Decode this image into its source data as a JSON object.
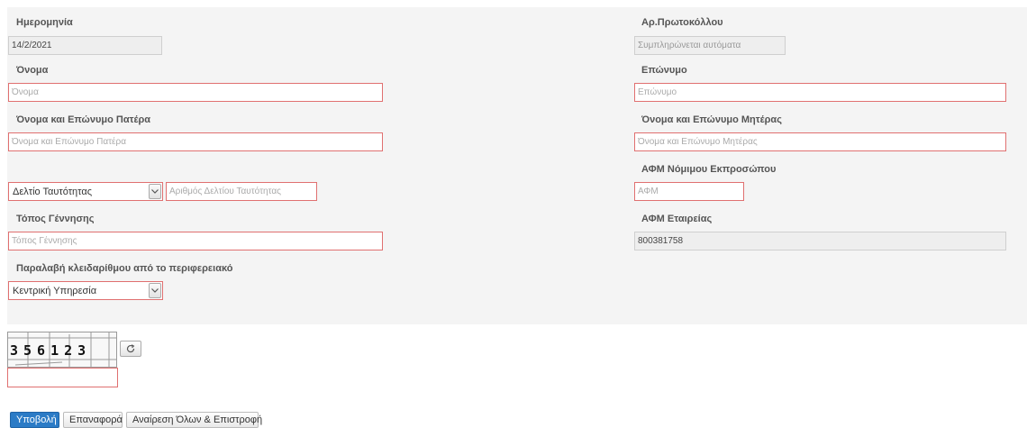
{
  "form": {
    "date": {
      "label": "Ημερομηνία",
      "value": "14/2/2021"
    },
    "protocol": {
      "label": "Αρ.Πρωτοκόλλου",
      "placeholder": "Συμπληρώνεται αυτόματα"
    },
    "first_name": {
      "label": "Όνομα",
      "placeholder": "Όνομα"
    },
    "last_name": {
      "label": "Επώνυμο",
      "placeholder": "Επώνυμο"
    },
    "father_name": {
      "label": "Όνομα και Επώνυμο Πατέρα",
      "placeholder": "Όνομα και Επώνυμο Πατέρα"
    },
    "mother_name": {
      "label": "Όνομα και Επώνυμο Μητέρας",
      "placeholder": "Όνομα και Επώνυμο Μητέρας"
    },
    "id_type": {
      "selected": "Δελτίο Ταυτότητας"
    },
    "id_number": {
      "placeholder": "Αριθμός Δελτίου Ταυτότητας"
    },
    "legal_rep_afm": {
      "label": "ΑΦΜ Νόμιμου Εκπροσώπου",
      "placeholder": "ΑΦΜ"
    },
    "birthplace": {
      "label": "Τόπος Γέννησης",
      "placeholder": "Τόπος Γέννησης"
    },
    "company_afm": {
      "label": "ΑΦΜ Εταιρείας",
      "value": "800381758"
    },
    "keyboard_pickup": {
      "label": "Παραλαβή κλειδαρίθμου από το περιφερειακό",
      "selected": "Κεντρική Υπηρεσία"
    }
  },
  "captcha": {
    "code": "356123",
    "input_value": ""
  },
  "icons": {
    "select_caret": "chevron-down-icon",
    "captcha_refresh": "refresh-icon"
  },
  "colors": {
    "primary_button": "#2b7bc6",
    "invalid_border": "#e07070"
  },
  "buttons": {
    "submit": "Υποβολή",
    "reset": "Επαναφορά",
    "clear_return": "Αναίρεση Όλων & Επιστροφή"
  }
}
